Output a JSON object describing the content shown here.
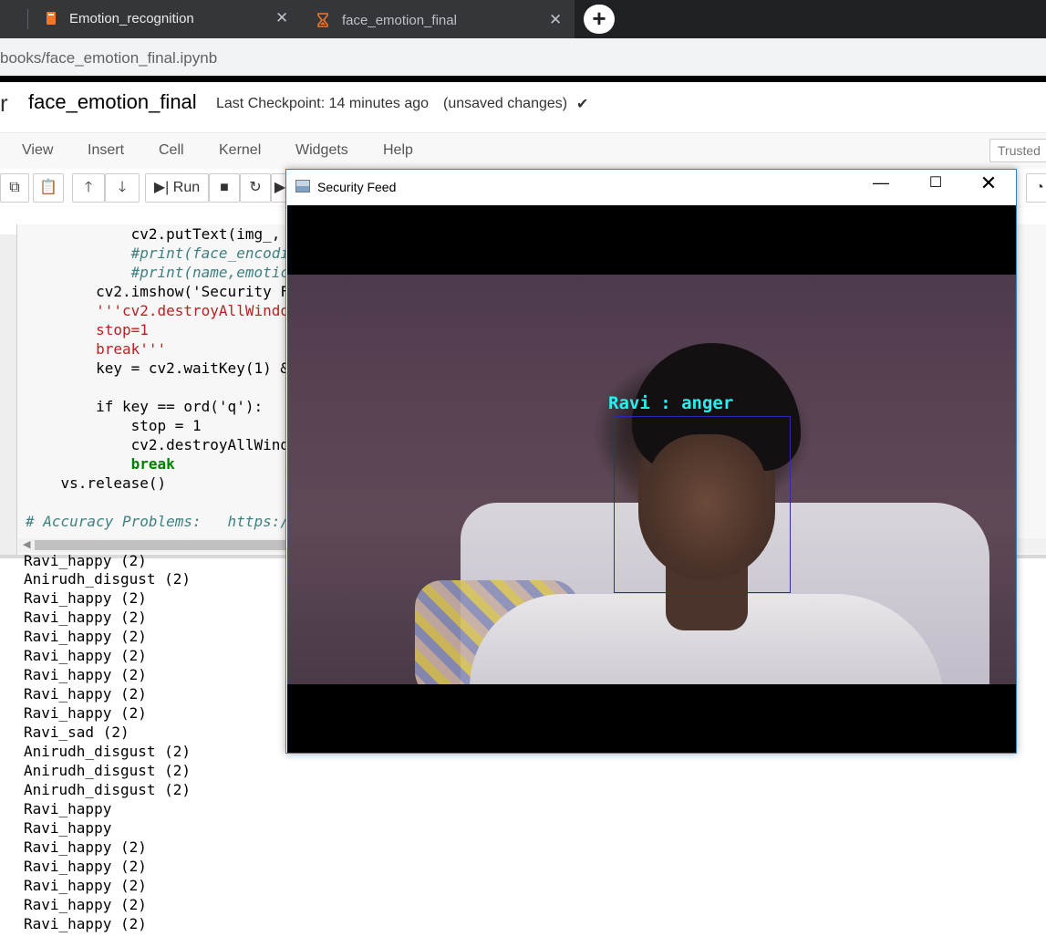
{
  "browser": {
    "tabs": [
      {
        "label": "Emotion_recognition",
        "close": "✕"
      },
      {
        "label": "face_emotion_final",
        "close": "✕"
      }
    ],
    "new_tab": "+",
    "url": "books/face_emotion_final.ipynb"
  },
  "jupyter": {
    "logo_fragment": "r",
    "notebook_name": "face_emotion_final",
    "checkpoint": "Last Checkpoint: 14 minutes ago",
    "status": "(unsaved changes)",
    "menu": [
      "View",
      "Insert",
      "Cell",
      "Kernel",
      "Widgets",
      "Help"
    ],
    "trusted": "Trusted",
    "toolbar": {
      "run_label": "Run"
    }
  },
  "code_cell": {
    "lines": [
      {
        "indent": "            ",
        "text": "cv2.putText(img_,",
        "cls": "nm"
      },
      {
        "indent": "            ",
        "text": "#print(face_encodi",
        "cls": "cm"
      },
      {
        "indent": "            ",
        "text": "#print(name,emotic",
        "cls": "cm"
      },
      {
        "indent": "        ",
        "text": "cv2.imshow('Security F",
        "cls": "nm"
      },
      {
        "indent": "        ",
        "text": "'''cv2.destroyAllWindo",
        "cls": "str"
      },
      {
        "indent": "        ",
        "text": "stop=1",
        "cls": "str"
      },
      {
        "indent": "        ",
        "text": "break'''",
        "cls": "str"
      },
      {
        "indent": "        ",
        "text": "key = cv2.waitKey(1) &",
        "cls": "nm"
      },
      {
        "indent": "",
        "text": "",
        "cls": "nm"
      },
      {
        "indent": "        ",
        "text": "if key == ord('q'):",
        "cls": "nm"
      },
      {
        "indent": "            ",
        "text": "stop = 1",
        "cls": "nm"
      },
      {
        "indent": "            ",
        "text": "cv2.destroyAllWind",
        "cls": "nm"
      },
      {
        "indent": "            ",
        "text": "break",
        "cls": "kw"
      },
      {
        "indent": "    ",
        "text": "vs.release()",
        "cls": "nm"
      },
      {
        "indent": "",
        "text": "",
        "cls": "nm"
      },
      {
        "indent": "",
        "text": "# Accuracy Problems:   https:/",
        "cls": "cm"
      }
    ]
  },
  "output": {
    "lines": [
      "Ravi_happy (2)",
      "Anirudh_disgust (2)",
      "Ravi_happy (2)",
      "Ravi_happy (2)",
      "Ravi_happy (2)",
      "Ravi_happy (2)",
      "Ravi_happy (2)",
      "Ravi_happy (2)",
      "Ravi_happy (2)",
      "Ravi_sad (2)",
      "Anirudh_disgust (2)",
      "Anirudh_disgust (2)",
      "Anirudh_disgust (2)",
      "Ravi_happy",
      "Ravi_happy",
      "Ravi_happy (2)",
      "Ravi_happy (2)",
      "Ravi_happy (2)",
      "Ravi_happy (2)",
      "Ravi_happy (2)"
    ]
  },
  "security_feed": {
    "title": "Security Feed",
    "minimize": "—",
    "maximize": "☐",
    "close": "✕",
    "face_label": "Ravi : anger"
  },
  "colors": {
    "face_box": "#2a2ab8",
    "face_label": "#28f0f0",
    "window_border": "#3c7fb1"
  }
}
